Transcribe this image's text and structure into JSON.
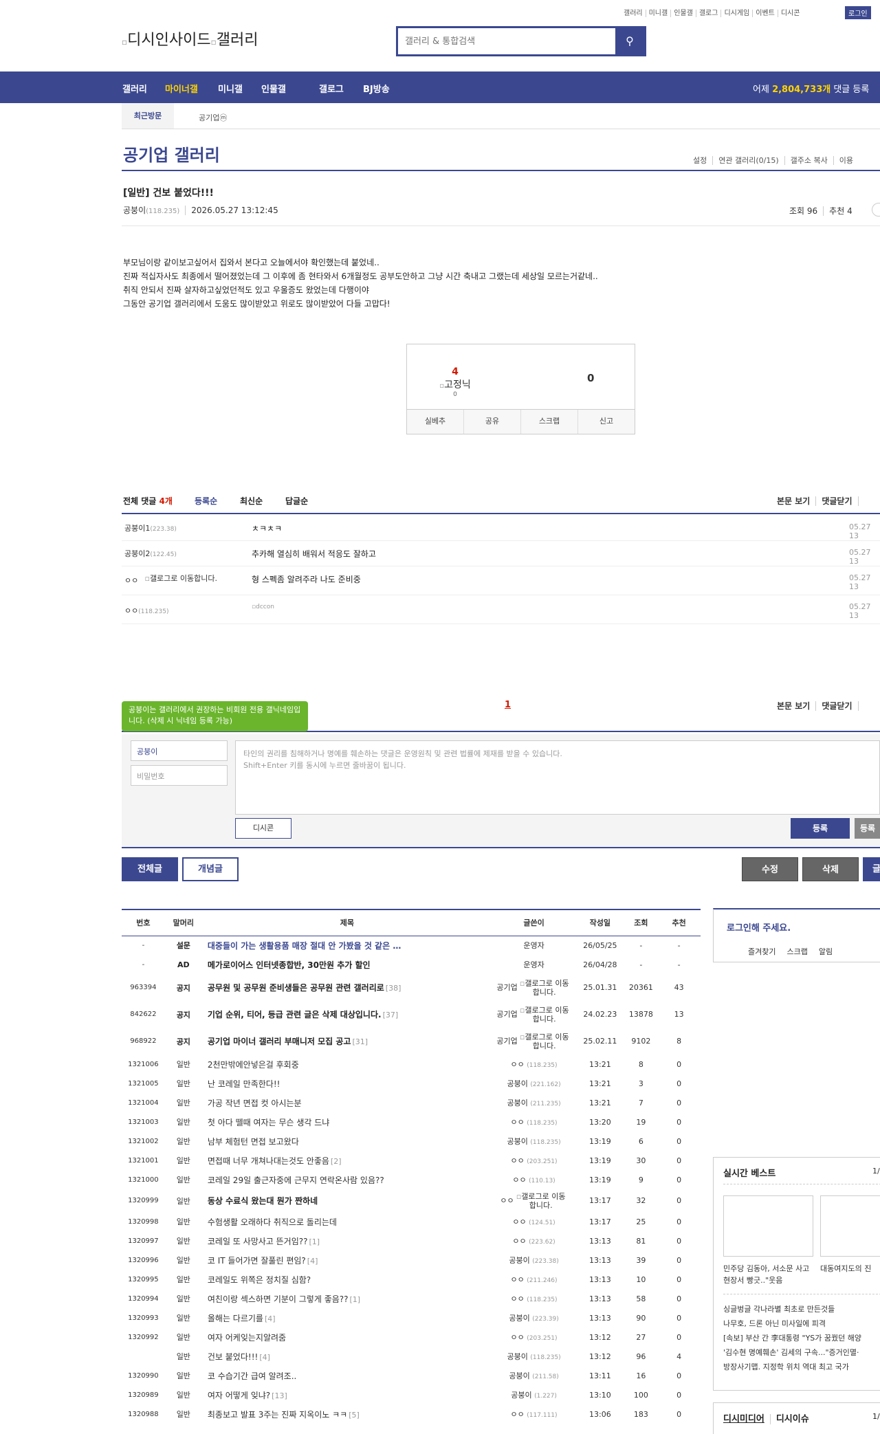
{
  "top_links": [
    "갤러리",
    "미니갤",
    "인물갤",
    "갤로그",
    "디시게임",
    "이벤트",
    "디시콘"
  ],
  "login_label": "로그인",
  "logo_alt_1": "디시인사이드",
  "logo_alt_2": "갤러리",
  "search_placeholder": "갤러리 & 통합검색",
  "gnb": {
    "items": [
      "갤러리",
      "마이너갤",
      "미니갤",
      "인물갤",
      "갤로그",
      "BJ방송"
    ],
    "comment_prefix": "어제 ",
    "comment_count": "2,804,733개",
    "comment_suffix": " 댓글 등록"
  },
  "subnav": {
    "recent": "최근방문",
    "tab": "공기업ⓜ"
  },
  "gallery": {
    "title": "공기업 갤러리",
    "options": [
      "설정",
      "연관 갤러리(0/15)",
      "갤주소 복사",
      "이용"
    ]
  },
  "post": {
    "title": "[일반] 건보 붙었다!!!",
    "writer": "공붕이",
    "writer_ip": "(118.235)",
    "date": "2026.05.27 13:12:45",
    "views": "조회 96",
    "recommends": "추천 4",
    "body": [
      "부모님이랑 같이보고싶어서 집와서 본다고 오늘에서야 확인했는데 붙었네..",
      "진짜 적십자사도 최종에서 떨어졌었는데 그 이후에 좀 현타와서 6개월정도 공부도안하고 그냥 시간 축내고 그랬는데 세상일 모르는거같네..",
      "취직 안되서 진짜 살자하고싶었던적도 있고 우울증도 왔었는데 다행이야",
      "그동안 공기업 갤러리에서 도움도 많이받았고 위로도 많이받았어 다들 고맙다!"
    ],
    "rec_up": "4",
    "rec_label": "고정닉",
    "rec_fixed": "0",
    "rec_down": "0",
    "rec_buttons": [
      "실베추",
      "공유",
      "스크랩",
      "신고"
    ]
  },
  "comments": {
    "total_label": "전체 댓글 ",
    "total_count": "4개",
    "sort": [
      "등록순",
      "최신순",
      "답글순"
    ],
    "right": [
      "본문 보기",
      "댓글닫기"
    ],
    "rows": [
      {
        "nick": "공붕이1",
        "ip": "(223.38)",
        "text": "ㅊㅋㅊㅋ",
        "time": "05.27 13"
      },
      {
        "nick": "공붕이2",
        "ip": "(122.45)",
        "text": "추카해 열심히 배워서 적응도 잘하고",
        "time": "05.27 13"
      },
      {
        "nick": "ㅇㅇ",
        "ip": "",
        "icon": "갤로그로 이동합니다.",
        "text": "형 스펙좀 알려주라 나도 준비중",
        "time": "05.27 13"
      },
      {
        "nick": "ㅇㅇ",
        "ip": "(118.235)",
        "text": "dccon",
        "time": "05.27 13"
      }
    ],
    "page": "1",
    "tooltip": "공붕이는 갤러리에서 권장하는 비회원 전용 갤닉네임입니다. (삭제 시 닉네임 등록 가능)",
    "nick_value": "공붕이",
    "pw_placeholder": "비밀번호",
    "text_placeholder_1": "타인의 권리를 침해하거나 명예를 훼손하는 댓글은 운영원칙 및 관련 법률에 제재를 받을 수 있습니다.",
    "text_placeholder_2": "Shift+Enter 키를 동시에 누르면 줄바꿈이 됩니다.",
    "dccon_btn": "디시콘",
    "reg_btn": "등록",
    "reg_btn2": "등록"
  },
  "board_buttons": {
    "all": "전체글",
    "concept": "개념글",
    "edit": "수정",
    "delete": "삭제",
    "write": "글"
  },
  "list_headers": [
    "번호",
    "말머리",
    "제목",
    "글쓴이",
    "작성일",
    "조회",
    "추천"
  ],
  "list_rows": [
    {
      "num": "-",
      "head": "설문",
      "subject": "대중들이 가는 생활용품 매장 절대 안 가봤을 것 같은 …",
      "reply": "",
      "writer": "운영자",
      "ip": "",
      "date": "26/05/25",
      "views": "-",
      "rec": "-",
      "type": "survey"
    },
    {
      "num": "-",
      "head": "AD",
      "subject": "메가로이어스 인터넷종합반, 30만원 추가 할인",
      "reply": "",
      "writer": "운영자",
      "ip": "",
      "date": "26/04/28",
      "views": "-",
      "rec": "-",
      "type": "ad"
    },
    {
      "num": "963394",
      "head": "공지",
      "subject": "공무원 및 공무원 준비생들은 공무원 관련 갤러리로",
      "reply": "[38]",
      "writer": "공기업",
      "ip": "",
      "icon": "갤로그로 이동합니다.",
      "date": "25.01.31",
      "views": "20361",
      "rec": "43",
      "type": "notice"
    },
    {
      "num": "842622",
      "head": "공지",
      "subject": "기업 순위, 티어, 등급 관련 글은 삭제 대상입니다.",
      "reply": "[37]",
      "writer": "공기업",
      "ip": "",
      "icon": "갤로그로 이동합니다.",
      "date": "24.02.23",
      "views": "13878",
      "rec": "13",
      "type": "notice"
    },
    {
      "num": "968922",
      "head": "공지",
      "subject": "공기업 마이너 갤러리 부매니저 모집 공고",
      "reply": "[31]",
      "writer": "공기업",
      "ip": "",
      "icon": "갤로그로 이동합니다.",
      "date": "25.02.11",
      "views": "9102",
      "rec": "8",
      "type": "notice"
    },
    {
      "num": "1321006",
      "head": "일반",
      "subject": "2천만밖에안넣은걸 후회중",
      "reply": "",
      "writer": "ㅇㅇ",
      "ip": "(118.235)",
      "date": "13:21",
      "views": "8",
      "rec": "0",
      "type": "normal"
    },
    {
      "num": "1321005",
      "head": "일반",
      "subject": "난 코레일 만족한다!!",
      "reply": "",
      "writer": "공붕이",
      "ip": "(221.162)",
      "date": "13:21",
      "views": "3",
      "rec": "0",
      "type": "normal"
    },
    {
      "num": "1321004",
      "head": "일반",
      "subject": "가공 작년 면접 컷 아시는분",
      "reply": "",
      "writer": "공붕이",
      "ip": "(211.235)",
      "date": "13:21",
      "views": "7",
      "rec": "0",
      "type": "normal"
    },
    {
      "num": "1321003",
      "head": "일반",
      "subject": "첫 아다 뗄때 여자는 무슨 생각 드냐",
      "reply": "",
      "writer": "ㅇㅇ",
      "ip": "(118.235)",
      "date": "13:20",
      "views": "19",
      "rec": "0",
      "type": "normal"
    },
    {
      "num": "1321002",
      "head": "일반",
      "subject": "남부 체험턴 면접 보고왔다",
      "reply": "",
      "writer": "공붕이",
      "ip": "(118.235)",
      "date": "13:19",
      "views": "6",
      "rec": "0",
      "type": "normal"
    },
    {
      "num": "1321001",
      "head": "일반",
      "subject": "면접때 너무 개쳐나대는것도 안좋음",
      "reply": "[2]",
      "writer": "ㅇㅇ",
      "ip": "(203.251)",
      "date": "13:19",
      "views": "30",
      "rec": "0",
      "type": "normal"
    },
    {
      "num": "1321000",
      "head": "일반",
      "subject": "코레일 29일 출근자중에 근무지 연락온사람 있음??",
      "reply": "",
      "writer": "ㅇㅇ",
      "ip": "(110.13)",
      "date": "13:19",
      "views": "9",
      "rec": "0",
      "type": "normal"
    },
    {
      "num": "1320999",
      "head": "일반",
      "subject": "동상 수료식 왔는대 뭔가 짠하네",
      "reply": "",
      "writer": "ㅇㅇ",
      "ip": "",
      "icon": "갤로그로 이동합니다.",
      "date": "13:17",
      "views": "32",
      "rec": "0",
      "type": "tall"
    },
    {
      "num": "1320998",
      "head": "일반",
      "subject": "수험생활 오래하다 취직으로 돌리는데",
      "reply": "",
      "writer": "ㅇㅇ",
      "ip": "(124.51)",
      "date": "13:17",
      "views": "25",
      "rec": "0",
      "type": "normal"
    },
    {
      "num": "1320997",
      "head": "일반",
      "subject": "코레일 또 사망사고 뜬거임??",
      "reply": "[1]",
      "writer": "ㅇㅇ",
      "ip": "(223.62)",
      "date": "13:13",
      "views": "81",
      "rec": "0",
      "type": "normal"
    },
    {
      "num": "1320996",
      "head": "일반",
      "subject": "코 IT 들어가면 잘풀린 편임?",
      "reply": "[4]",
      "writer": "공붕이",
      "ip": "(223.38)",
      "date": "13:13",
      "views": "39",
      "rec": "0",
      "type": "normal"
    },
    {
      "num": "1320995",
      "head": "일반",
      "subject": "코레일도 위쪽은 정치질 심함?",
      "reply": "",
      "writer": "ㅇㅇ",
      "ip": "(211.246)",
      "date": "13:13",
      "views": "10",
      "rec": "0",
      "type": "normal"
    },
    {
      "num": "1320994",
      "head": "일반",
      "subject": "여친이랑 섹스하면 기분이 그렇게 좋음??",
      "reply": "[1]",
      "writer": "ㅇㅇ",
      "ip": "(118.235)",
      "date": "13:13",
      "views": "58",
      "rec": "0",
      "type": "normal"
    },
    {
      "num": "1320993",
      "head": "일반",
      "subject": "올해는 다르기를",
      "reply": "[4]",
      "writer": "공붕이",
      "ip": "(223.39)",
      "date": "13:13",
      "views": "90",
      "rec": "0",
      "type": "normal"
    },
    {
      "num": "1320992",
      "head": "일반",
      "subject": "여자 어케잊는지알려줌",
      "reply": "",
      "writer": "ㅇㅇ",
      "ip": "(203.251)",
      "date": "13:12",
      "views": "27",
      "rec": "0",
      "type": "normal"
    },
    {
      "num": "",
      "head": "일반",
      "subject": "건보 붙었다!!!",
      "reply": "[4]",
      "writer": "공붕이",
      "ip": "(118.235)",
      "date": "13:12",
      "views": "96",
      "rec": "4",
      "type": "normal"
    },
    {
      "num": "1320990",
      "head": "일반",
      "subject": "코 수습기간 급여 알려조..",
      "reply": "",
      "writer": "공붕이",
      "ip": "(211.58)",
      "date": "13:11",
      "views": "16",
      "rec": "0",
      "type": "normal"
    },
    {
      "num": "1320989",
      "head": "일반",
      "subject": "여자 어떻게 잊냐?",
      "reply": "[13]",
      "writer": "공붕이",
      "ip": "(1.227)",
      "date": "13:10",
      "views": "100",
      "rec": "0",
      "type": "normal"
    },
    {
      "num": "1320988",
      "head": "일반",
      "subject": "최종보고 발표 3주는 진짜 지옥이노 ㅋㅋ",
      "reply": "[5]",
      "writer": "ㅇㅇ",
      "ip": "(117.111)",
      "date": "13:06",
      "views": "183",
      "rec": "0",
      "type": "normal"
    }
  ],
  "side": {
    "login_title": "로그인해 주세요.",
    "login_links": [
      "즐겨찾기",
      "스크랩",
      "알림"
    ],
    "best_title": "실시간 베스트",
    "best_page": "1/",
    "best_cap1": "민주당 김동아, 서소문 사고 현장서 빵긋..\"웃음",
    "best_cap2": "대동여지도의 진",
    "best_list": [
      "싱글벙글 각나라별 최초로 만든것들",
      "나무호, 드론 아닌 미사일에 피격",
      "[속보] 부산 간 李대통령 \"YS가 꿈꿨던 해양",
      "'김수현 명예훼손' 김세의 구속...\"증거인멸·",
      "방장사기맵. 지정학 위치 역대 최고 국가"
    ],
    "media": [
      "디시미디어",
      "디시이슈"
    ],
    "media_page": "1/"
  }
}
